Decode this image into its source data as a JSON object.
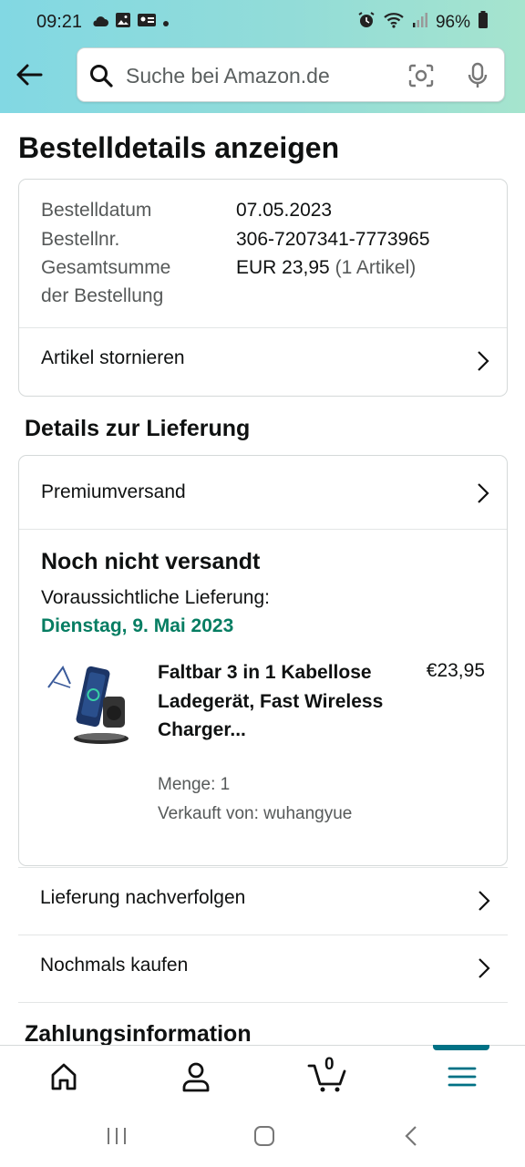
{
  "status_bar": {
    "time": "09:21",
    "battery": "96%"
  },
  "search": {
    "placeholder": "Suche bei Amazon.de"
  },
  "page_title": "Bestelldetails anzeigen",
  "order_summary": {
    "date_label": "Bestelldatum",
    "date_value": "07.05.2023",
    "number_label": "Bestellnr.",
    "number_value": "306-7207341-7773965",
    "total_label_line1": "Gesamtsumme",
    "total_label_line2": "der Bestellung",
    "total_value": "EUR 23,95",
    "total_count": "(1 Artikel)",
    "cancel_label": "Artikel stornieren"
  },
  "delivery": {
    "heading": "Details zur Lieferung",
    "shipping_method": "Premiumversand",
    "status": "Noch nicht versandt",
    "estimate_label": "Voraussichtliche Lieferung:",
    "estimate_date": "Dienstag, 9. Mai 2023",
    "item": {
      "title": "Faltbar 3 in 1 Kabellose Ladegerät, Fast Wireless Charger...",
      "price": "€23,95",
      "quantity": "Menge: 1",
      "seller": "Verkauft von: wuhangyue"
    },
    "track_label": "Lieferung nachverfolgen",
    "buy_again_label": "Nochmals kaufen"
  },
  "payment_heading": "Zahlungsinformation",
  "bottom_nav": {
    "cart_count": "0",
    "items": [
      "home-icon",
      "account-icon",
      "cart-icon",
      "menu-icon"
    ],
    "accent": "#007185"
  },
  "colors": {
    "delivery_date": "#067d62",
    "header_start": "#82d8e3",
    "header_end": "#a6e4ce"
  }
}
